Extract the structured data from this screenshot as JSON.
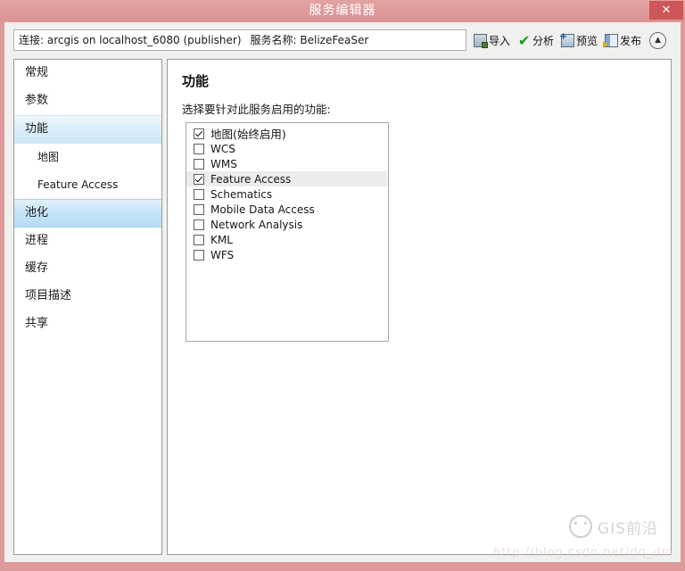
{
  "window": {
    "title": "服务编辑器",
    "close_label": "✕"
  },
  "connection_bar": {
    "connection_label": "连接: arcgis on localhost_6080 (publisher)",
    "service_name_label": "服务名称: BelizeFeaSer",
    "tools": [
      {
        "label": "导入",
        "icon": "import-icon"
      },
      {
        "label": "分析",
        "icon": "check-icon"
      },
      {
        "label": "预览",
        "icon": "preview-icon"
      },
      {
        "label": "发布",
        "icon": "publish-icon"
      }
    ],
    "collapse_icon": "chevron-up-icon"
  },
  "sidebar": {
    "items": [
      {
        "label": "常规",
        "state": "normal",
        "sub": false
      },
      {
        "label": "参数",
        "state": "normal",
        "sub": false
      },
      {
        "label": "功能",
        "state": "selected-light",
        "sub": false
      },
      {
        "label": "地图",
        "state": "normal",
        "sub": true
      },
      {
        "label": "Feature Access",
        "state": "normal",
        "sub": true
      },
      {
        "label": "池化",
        "state": "selected-strong",
        "sub": false
      },
      {
        "label": "进程",
        "state": "normal",
        "sub": false
      },
      {
        "label": "缓存",
        "state": "normal",
        "sub": false
      },
      {
        "label": "项目描述",
        "state": "normal",
        "sub": false
      },
      {
        "label": "共享",
        "state": "normal",
        "sub": false
      }
    ]
  },
  "content": {
    "title": "功能",
    "subtitle": "选择要针对此服务启用的功能:",
    "capabilities": [
      {
        "label": "地图(始终启用)",
        "checked": true,
        "highlighted": false,
        "cjk": true
      },
      {
        "label": "WCS",
        "checked": false,
        "highlighted": false,
        "cjk": false
      },
      {
        "label": "WMS",
        "checked": false,
        "highlighted": false,
        "cjk": false
      },
      {
        "label": "Feature Access",
        "checked": true,
        "highlighted": true,
        "cjk": false
      },
      {
        "label": "Schematics",
        "checked": false,
        "highlighted": false,
        "cjk": false
      },
      {
        "label": "Mobile Data Access",
        "checked": false,
        "highlighted": false,
        "cjk": false
      },
      {
        "label": "Network Analysis",
        "checked": false,
        "highlighted": false,
        "cjk": false
      },
      {
        "label": "KML",
        "checked": false,
        "highlighted": false,
        "cjk": false
      },
      {
        "label": "WFS",
        "checked": false,
        "highlighted": false,
        "cjk": false
      }
    ]
  },
  "watermark": {
    "logo_text": "GIS前沿",
    "url_text": "http://blog.csdn.net/dq_dm"
  },
  "colors": {
    "titlebar": "#dd9a9a",
    "close_button": "#cd5757",
    "accent_selected": "#b4dcf4",
    "row_highlight": "#ececec",
    "check_green": "#179c17"
  }
}
